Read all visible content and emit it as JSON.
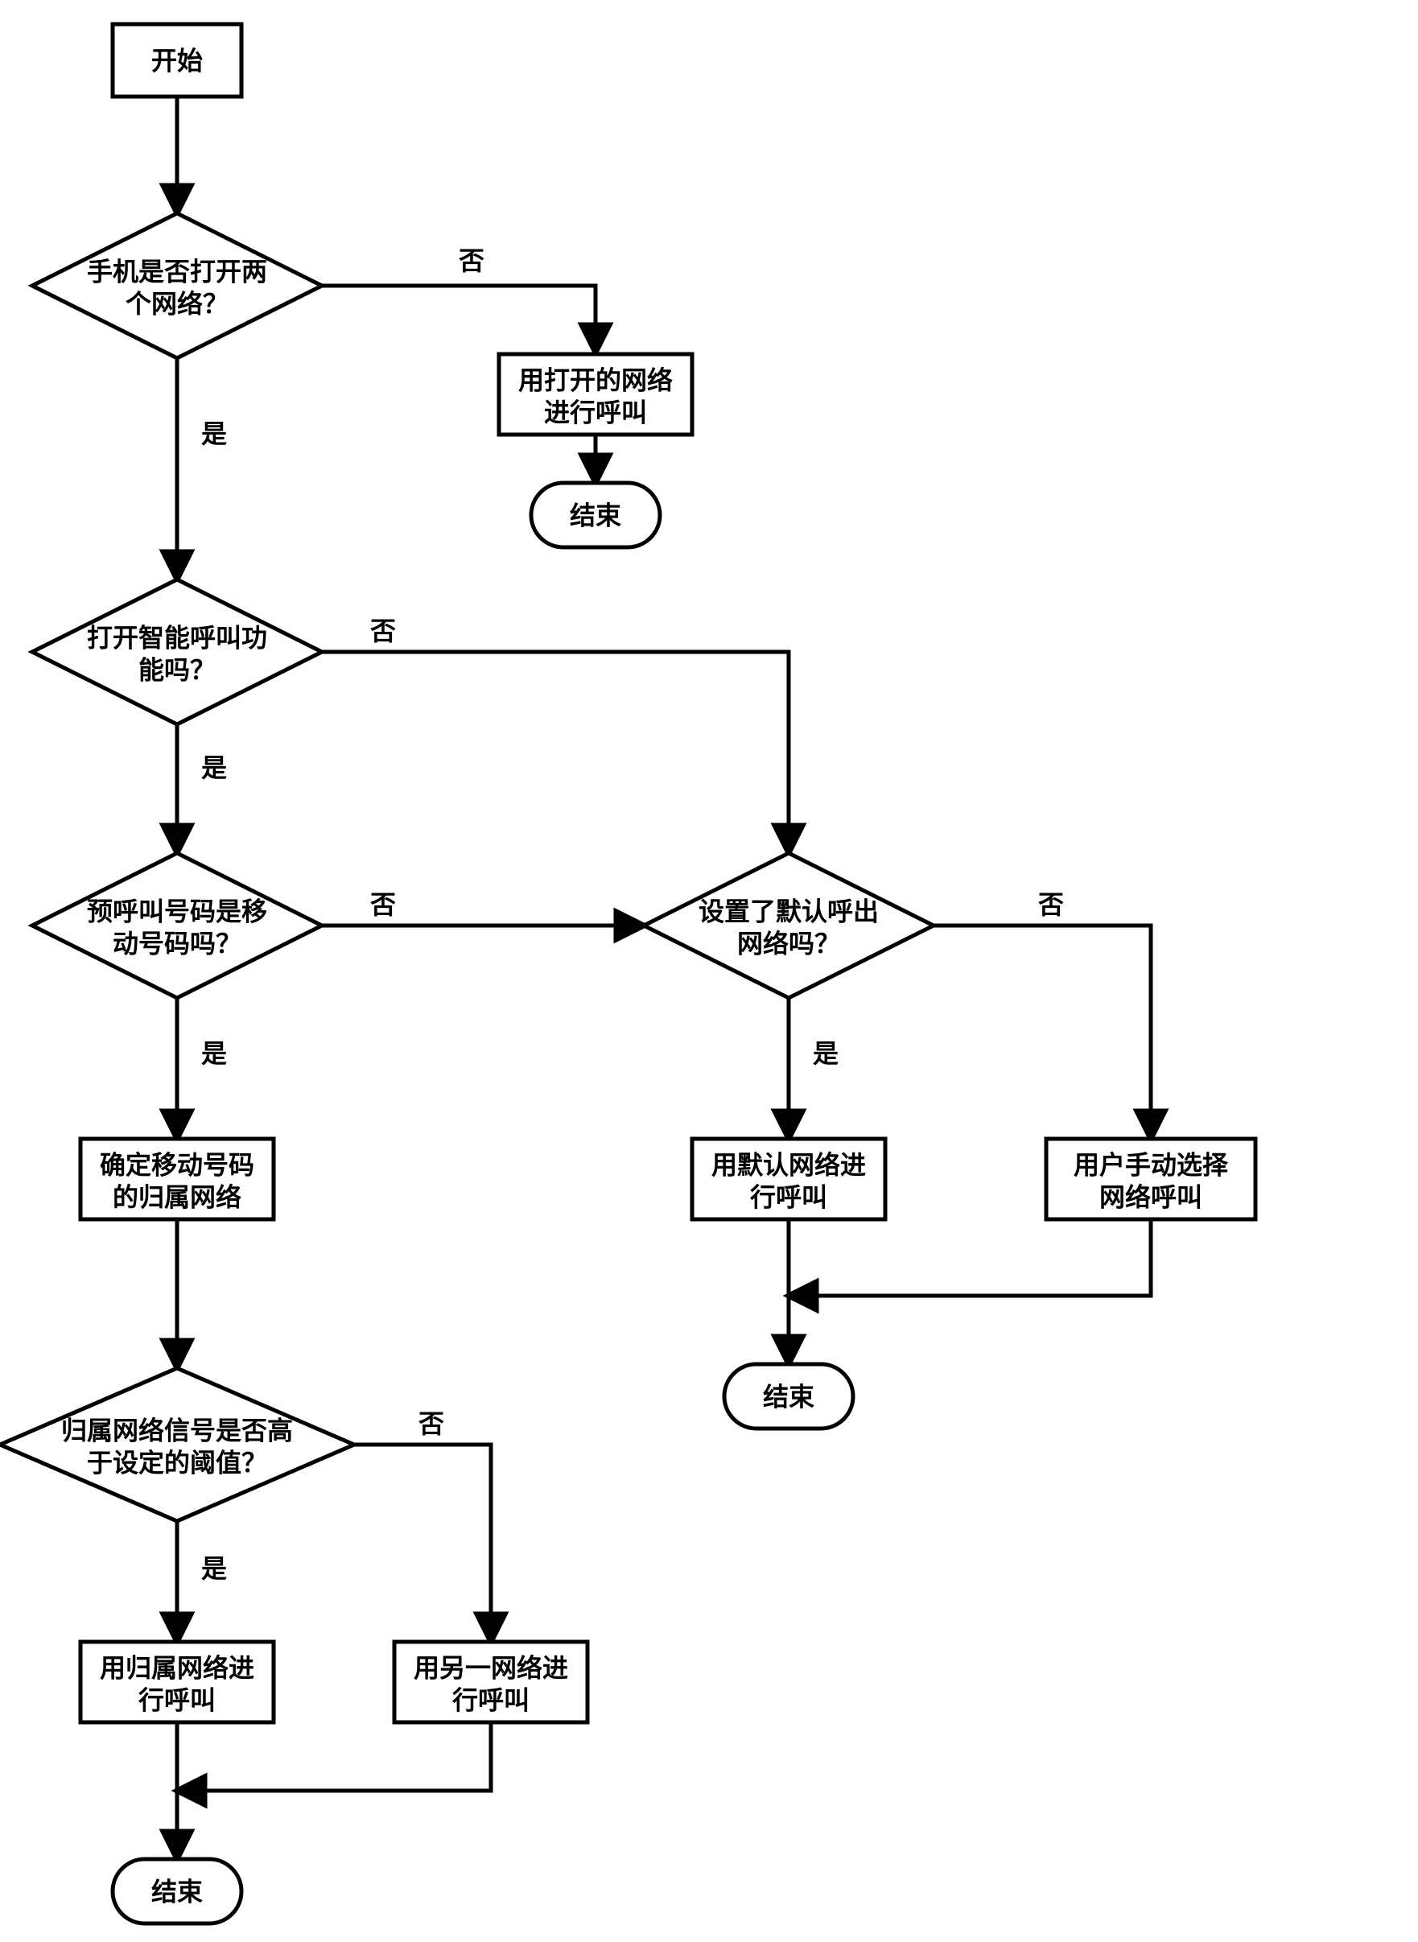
{
  "nodes": {
    "start": {
      "label": "开始"
    },
    "d_both_open": {
      "l1": "手机是否打开两",
      "l2": "个网络？"
    },
    "p_use_open": {
      "l1": "用打开的网络",
      "l2": "进行呼叫"
    },
    "end1": {
      "label": "结束"
    },
    "d_smart_enabled": {
      "l1": "打开智能呼叫功",
      "l2": "能吗？"
    },
    "d_is_mobile": {
      "l1": "预呼叫号码是移",
      "l2": "动号码吗？"
    },
    "d_default_out": {
      "l1": "设置了默认呼出",
      "l2": "网络吗？"
    },
    "p_use_default": {
      "l1": "用默认网络进",
      "l2": "行呼叫"
    },
    "p_manual": {
      "l1": "用户手动选择",
      "l2": "网络呼叫"
    },
    "end2": {
      "label": "结束"
    },
    "p_home_net": {
      "l1": "确定移动号码",
      "l2": "的归属网络"
    },
    "d_signal": {
      "l1": "归属网络信号是否高",
      "l2": "于设定的阈值？"
    },
    "p_use_home": {
      "l1": "用归属网络进",
      "l2": "行呼叫"
    },
    "p_use_other": {
      "l1": "用另一网络进",
      "l2": "行呼叫"
    },
    "end3": {
      "label": "结束"
    }
  },
  "labels": {
    "yes": "是",
    "no": "否"
  }
}
